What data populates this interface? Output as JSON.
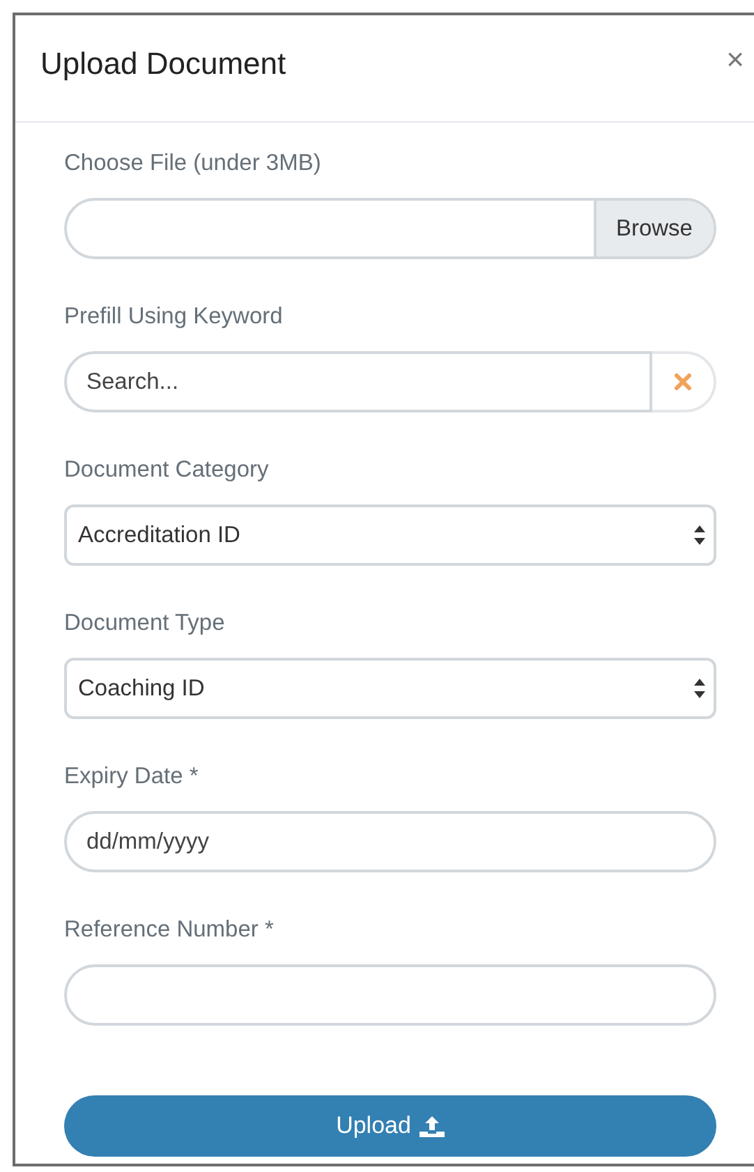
{
  "dialog": {
    "title": "Upload Document",
    "close": "×"
  },
  "fields": [
    {
      "kind": "file",
      "label": "Choose File (under 3MB)",
      "button": "Browse"
    },
    {
      "kind": "search",
      "label": "Prefill Using Keyword",
      "placeholder": "Search..."
    },
    {
      "kind": "select",
      "label": "Document Category",
      "value": "Accreditation ID"
    },
    {
      "kind": "select",
      "label": "Document Type",
      "value": "Coaching ID"
    },
    {
      "kind": "text",
      "label": "Expiry Date *",
      "placeholder": "dd/mm/yyyy"
    },
    {
      "kind": "text",
      "label": "Reference Number *"
    }
  ],
  "submit": {
    "label": "Upload"
  }
}
